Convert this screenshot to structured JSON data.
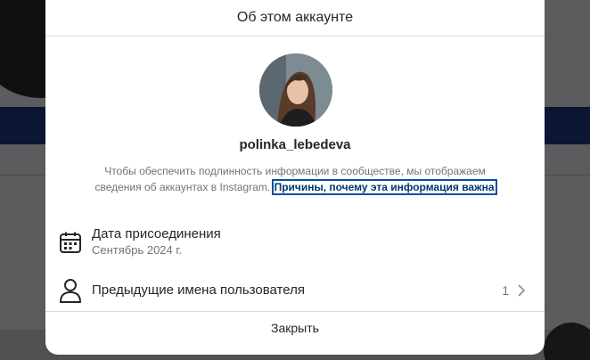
{
  "dialog": {
    "title": "Об этом аккаунте",
    "username": "polinka_lebedeva",
    "info_text": "Чтобы обеспечить подлинность информации в сообществе, мы отображаем сведения об аккаунтах в Instagram.",
    "info_link": "Причины, почему эта информация важна",
    "joined": {
      "label": "Дата присоединения",
      "value": "Сентябрь 2024 г.",
      "icon": "calendar-icon"
    },
    "previous_usernames": {
      "label": "Предыдущие имена пользователя",
      "count": "1",
      "icon": "user-icon"
    },
    "close_label": "Закрыть"
  },
  "colors": {
    "text_primary": "#262626",
    "text_secondary": "#737373",
    "link": "#00376b",
    "focus_outline": "#0a4fa0",
    "divider": "#dbdbdb"
  }
}
